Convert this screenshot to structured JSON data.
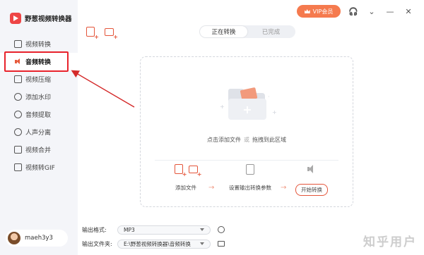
{
  "app": {
    "title": "野葱视频转换器"
  },
  "sidebar": {
    "items": [
      {
        "label": "视频转换",
        "icon": "video-icon"
      },
      {
        "label": "音频转换",
        "icon": "speaker-icon",
        "active": true
      },
      {
        "label": "视频压缩",
        "icon": "compress-icon"
      },
      {
        "label": "添加水印",
        "icon": "watermark-icon"
      },
      {
        "label": "音频提取",
        "icon": "audio-extract-icon"
      },
      {
        "label": "人声分离",
        "icon": "voice-separate-icon"
      },
      {
        "label": "视频合并",
        "icon": "merge-icon"
      },
      {
        "label": "视频转GIF",
        "icon": "gif-icon"
      }
    ],
    "user": {
      "name": "maeh3y3"
    }
  },
  "topbar": {
    "vip_label": "VIP会员",
    "icons": [
      "headset-icon",
      "chevron-icon",
      "minimize-icon",
      "close-icon"
    ]
  },
  "tabs": [
    {
      "label": "正在转换",
      "active": true
    },
    {
      "label": "已完成",
      "active": false
    }
  ],
  "dropzone": {
    "hint_add": "点击添加文件",
    "hint_or": "或",
    "hint_drag": "拖拽到此区域",
    "steps": [
      {
        "label": "添加文件"
      },
      {
        "label": "设置输出转换参数"
      },
      {
        "label": "开始转换"
      }
    ]
  },
  "output": {
    "format_label": "输出格式:",
    "format_value": "MP3",
    "folder_label": "输出文件夹:",
    "folder_value": "E:\\野葱视频转换器\\音频转换"
  },
  "watermark": "知乎用户",
  "colors": {
    "accent": "#e4553a",
    "highlight": "#e8232c",
    "vip": "#f57a4e"
  }
}
